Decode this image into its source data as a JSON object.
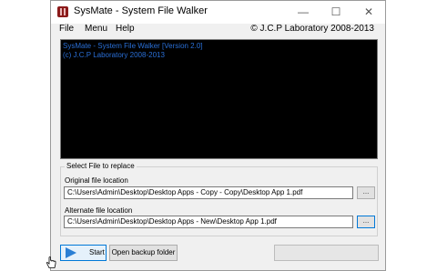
{
  "window": {
    "title": "SysMate - System File Walker"
  },
  "menu": {
    "items": [
      "File",
      "Menu",
      "Help"
    ],
    "copyright": "© J.C.P Laboratory 2008-2013"
  },
  "console": {
    "lines": [
      "SysMate - System File Walker [Version 2.0]",
      "(c) J.C.P Laboratory 2008-2013"
    ],
    "text_color": "#2a6fd6"
  },
  "replace_group": {
    "label": "Select File to replace",
    "original_label": "Original file location",
    "original_value": "C:\\Users\\Admin\\Desktop\\Desktop Apps - Copy - Copy\\Desktop App 1.pdf",
    "alternate_label": "Alternate file location",
    "alternate_value": "C:\\Users\\Admin\\Desktop\\Desktop Apps - New\\Desktop App 1.pdf",
    "browse_label": "..."
  },
  "actions": {
    "start_label": "Start",
    "backup_label": "Open backup folder",
    "progress_percent": 0
  }
}
